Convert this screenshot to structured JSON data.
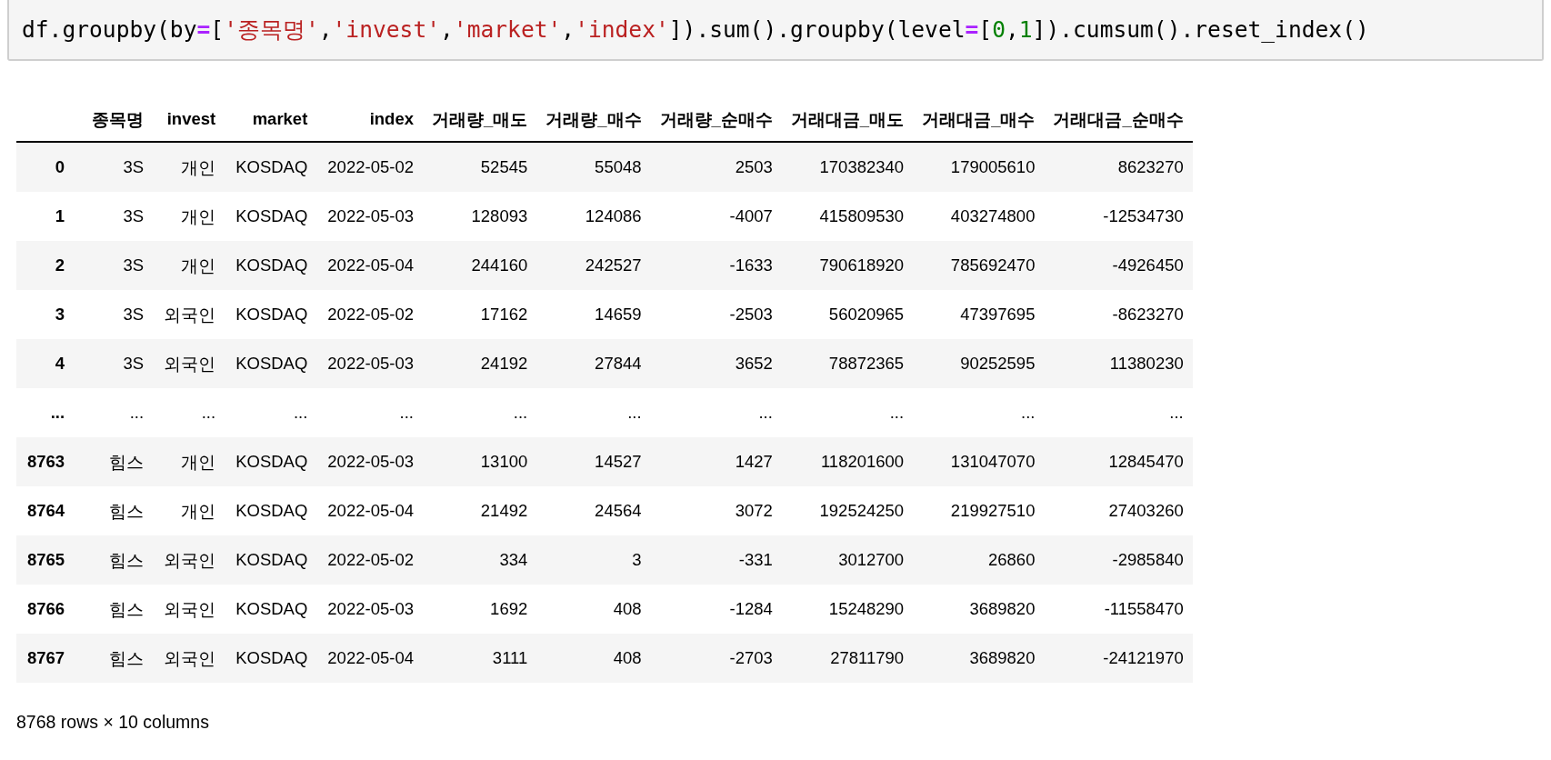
{
  "code_cell": {
    "tokens": [
      {
        "kind": "plain",
        "text": "df.groupby(by"
      },
      {
        "kind": "operator",
        "text": "="
      },
      {
        "kind": "plain",
        "text": "["
      },
      {
        "kind": "string",
        "text": "'종목명'"
      },
      {
        "kind": "plain",
        "text": ","
      },
      {
        "kind": "string",
        "text": "'invest'"
      },
      {
        "kind": "plain",
        "text": ","
      },
      {
        "kind": "string",
        "text": "'market'"
      },
      {
        "kind": "plain",
        "text": ","
      },
      {
        "kind": "string",
        "text": "'index'"
      },
      {
        "kind": "plain",
        "text": "]).sum().groupby(level"
      },
      {
        "kind": "operator",
        "text": "="
      },
      {
        "kind": "plain",
        "text": "["
      },
      {
        "kind": "number",
        "text": "0"
      },
      {
        "kind": "plain",
        "text": ","
      },
      {
        "kind": "number",
        "text": "1"
      },
      {
        "kind": "plain",
        "text": "]).cumsum().reset_index()"
      }
    ]
  },
  "table": {
    "columns": [
      "종목명",
      "invest",
      "market",
      "index",
      "거래량_매도",
      "거래량_매수",
      "거래량_순매수",
      "거래대금_매도",
      "거래대금_매수",
      "거래대금_순매수"
    ],
    "rows": [
      {
        "index": "0",
        "cells": [
          "3S",
          "개인",
          "KOSDAQ",
          "2022-05-02",
          "52545",
          "55048",
          "2503",
          "170382340",
          "179005610",
          "8623270"
        ]
      },
      {
        "index": "1",
        "cells": [
          "3S",
          "개인",
          "KOSDAQ",
          "2022-05-03",
          "128093",
          "124086",
          "-4007",
          "415809530",
          "403274800",
          "-12534730"
        ]
      },
      {
        "index": "2",
        "cells": [
          "3S",
          "개인",
          "KOSDAQ",
          "2022-05-04",
          "244160",
          "242527",
          "-1633",
          "790618920",
          "785692470",
          "-4926450"
        ]
      },
      {
        "index": "3",
        "cells": [
          "3S",
          "외국인",
          "KOSDAQ",
          "2022-05-02",
          "17162",
          "14659",
          "-2503",
          "56020965",
          "47397695",
          "-8623270"
        ]
      },
      {
        "index": "4",
        "cells": [
          "3S",
          "외국인",
          "KOSDAQ",
          "2022-05-03",
          "24192",
          "27844",
          "3652",
          "78872365",
          "90252595",
          "11380230"
        ]
      },
      {
        "index": "...",
        "cells": [
          "...",
          "...",
          "...",
          "...",
          "...",
          "...",
          "...",
          "...",
          "...",
          "..."
        ]
      },
      {
        "index": "8763",
        "cells": [
          "힘스",
          "개인",
          "KOSDAQ",
          "2022-05-03",
          "13100",
          "14527",
          "1427",
          "118201600",
          "131047070",
          "12845470"
        ]
      },
      {
        "index": "8764",
        "cells": [
          "힘스",
          "개인",
          "KOSDAQ",
          "2022-05-04",
          "21492",
          "24564",
          "3072",
          "192524250",
          "219927510",
          "27403260"
        ]
      },
      {
        "index": "8765",
        "cells": [
          "힘스",
          "외국인",
          "KOSDAQ",
          "2022-05-02",
          "334",
          "3",
          "-331",
          "3012700",
          "26860",
          "-2985840"
        ]
      },
      {
        "index": "8766",
        "cells": [
          "힘스",
          "외국인",
          "KOSDAQ",
          "2022-05-03",
          "1692",
          "408",
          "-1284",
          "15248290",
          "3689820",
          "-11558470"
        ]
      },
      {
        "index": "8767",
        "cells": [
          "힘스",
          "외국인",
          "KOSDAQ",
          "2022-05-04",
          "3111",
          "408",
          "-2703",
          "27811790",
          "3689820",
          "-24121970"
        ]
      }
    ]
  },
  "footer": "8768 rows × 10 columns"
}
